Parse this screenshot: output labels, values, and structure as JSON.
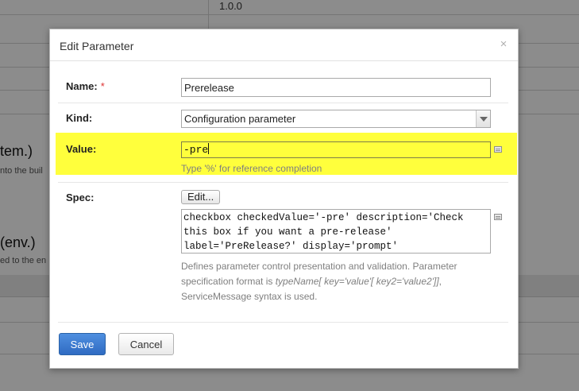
{
  "background": {
    "version_text": "1.0.0",
    "heading_1": "tem.)",
    "subtext_1": "nto the buil",
    "heading_2": "(env.)",
    "subtext_2": "ed to the en"
  },
  "dialog": {
    "title": "Edit Parameter",
    "close_symbol": "×",
    "fields": {
      "name": {
        "label": "Name:",
        "required_mark": "*",
        "value": "Prerelease"
      },
      "kind": {
        "label": "Kind:",
        "selected": "Configuration parameter"
      },
      "value": {
        "label": "Value:",
        "value": "-pre",
        "hint": "Type '%' for reference completion"
      },
      "spec": {
        "label": "Spec:",
        "edit_button": "Edit...",
        "value": "checkbox checkedValue='-pre' description='Check this box if you want a pre-release' label='PreRelease?' display='prompt'",
        "hint_prefix": "Defines parameter control presentation and validation. Parameter specification format is ",
        "hint_format": "typeName[ key='value'[ key2='value2']]",
        "hint_suffix": ", ServiceMessage syntax is used."
      }
    },
    "buttons": {
      "save": "Save",
      "cancel": "Cancel"
    }
  },
  "colors": {
    "highlight": "#ffff3c",
    "primary_button": "#2f6bc2",
    "required": "#dd3333"
  },
  "icons": [
    "close-icon",
    "chevron-down-icon",
    "reference-picker-icon"
  ]
}
